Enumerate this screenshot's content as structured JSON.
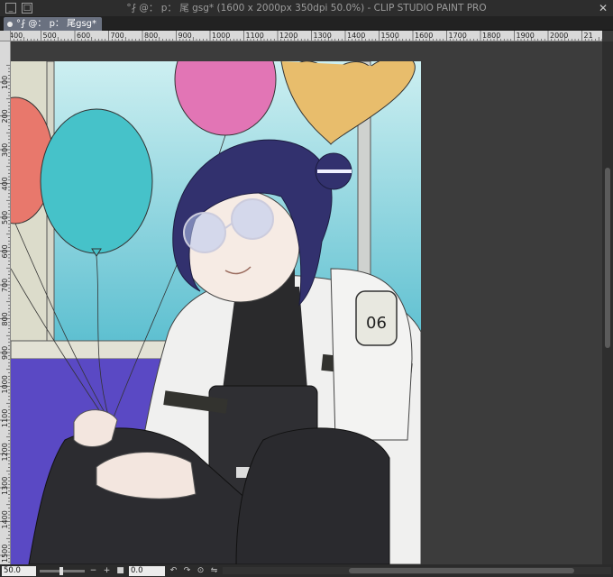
{
  "window": {
    "title": "°⨏ @： p： 尾 gsg* (1600 x 2000px 350dpi 50.0%)  - CLIP STUDIO PAINT PRO",
    "minimize_label": "_",
    "maximize_label": "□",
    "close_label": "✕"
  },
  "tab": {
    "label": "°⨏ @： p： 尾gsg*"
  },
  "rulers": {
    "horizontal_labels": [
      "400",
      "500",
      "600",
      "700",
      "800",
      "900",
      "1000",
      "1100",
      "1200",
      "1300",
      "1400",
      "1500",
      "1600",
      "1700",
      "1800",
      "1900",
      "2000",
      "21"
    ],
    "vertical_labels": [
      "100",
      "200",
      "300",
      "400",
      "500",
      "600",
      "700",
      "800",
      "900",
      "1000",
      "1100",
      "1200",
      "1300",
      "1400",
      "1500"
    ]
  },
  "status": {
    "zoom_value": "50.0",
    "rotation_value": "0.0",
    "zoom_out_icon": "minus-icon",
    "zoom_in_icon": "plus-icon",
    "rotate_left_icon": "rotate-left-icon",
    "rotate_right_icon": "rotate-right-icon",
    "reset_icon": "reset-icon",
    "flip_icon": "flip-icon"
  },
  "artwork": {
    "badge_number": "06",
    "colors": {
      "sky": "#8fd6dd",
      "floor": "#5a49c4",
      "balloon_red": "#e8786c",
      "balloon_teal": "#46c2c9",
      "balloon_pink": "#e275b5",
      "balloon_yellow": "#e8bd6c",
      "hair": "#32316e",
      "jacket": "#f0f0ef",
      "shirt": "#2a2a2c"
    }
  }
}
